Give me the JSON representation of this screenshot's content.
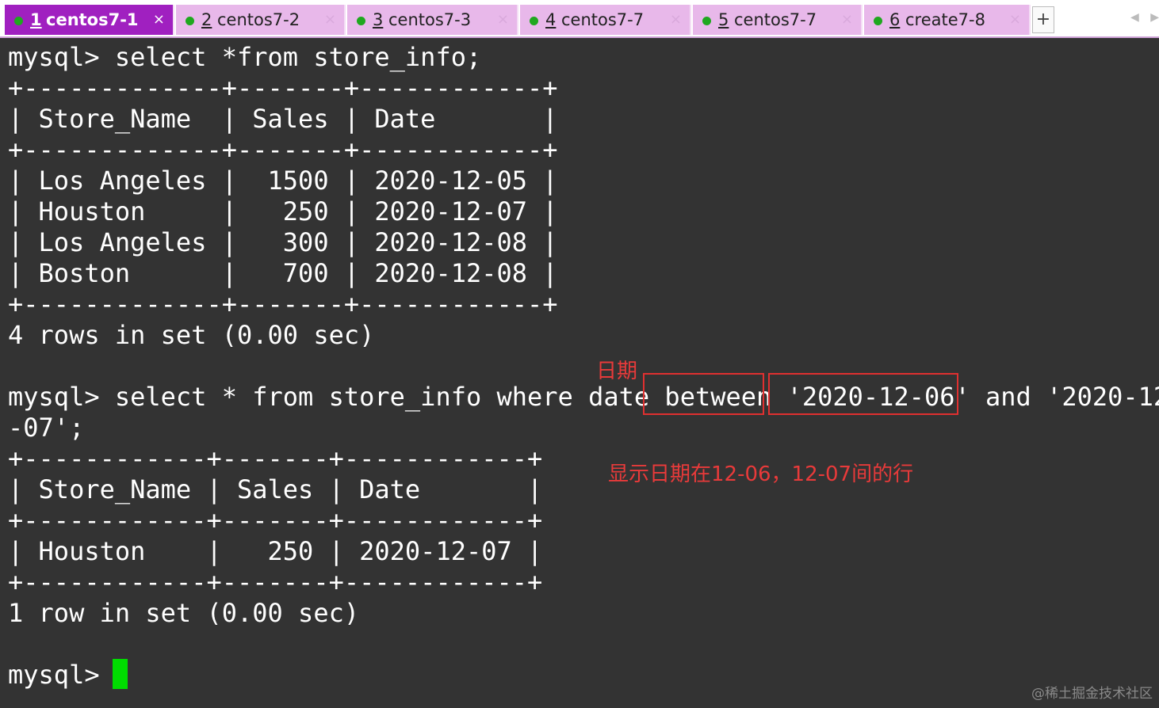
{
  "tabs": [
    {
      "num": "1",
      "name": "centos7-1",
      "active": true
    },
    {
      "num": "2",
      "name": "centos7-2",
      "active": false
    },
    {
      "num": "3",
      "name": "centos7-3",
      "active": false
    },
    {
      "num": "4",
      "name": "centos7-7",
      "active": false
    },
    {
      "num": "5",
      "name": "centos7-7",
      "active": false
    },
    {
      "num": "6",
      "name": "create7-8",
      "active": false
    }
  ],
  "tab_close": "×",
  "new_tab": "+",
  "scroll_left": "◀",
  "scroll_right": "▶",
  "terminal": {
    "lines": [
      "mysql> select *from store_info;",
      "+-------------+-------+------------+",
      "| Store_Name  | Sales | Date       |",
      "+-------------+-------+------------+",
      "| Los Angeles |  1500 | 2020-12-05 |",
      "| Houston     |   250 | 2020-12-07 |",
      "| Los Angeles |   300 | 2020-12-08 |",
      "| Boston      |   700 | 2020-12-08 |",
      "+-------------+-------+------------+",
      "4 rows in set (0.00 sec)",
      "",
      "mysql> select * from store_info where date between '2020-12-06' and '2020-12",
      "-07';",
      "+------------+-------+------------+",
      "| Store_Name | Sales | Date       |",
      "+------------+-------+------------+",
      "| Houston    |   250 | 2020-12-07 |",
      "+------------+-------+------------+",
      "1 row in set (0.00 sec)",
      "",
      "mysql> "
    ]
  },
  "annotations": {
    "label_date": "日期",
    "label_result": "显示日期在12-06，12-07间的行"
  },
  "watermark": "@稀土掘金技术社区",
  "colors": {
    "active_tab": "#a020c0",
    "inactive_tab": "#e8b8ea",
    "status_dot": "#1fa81f",
    "terminal_bg": "#333333",
    "cursor": "#00dd00",
    "annotation_red": "#e03030"
  }
}
